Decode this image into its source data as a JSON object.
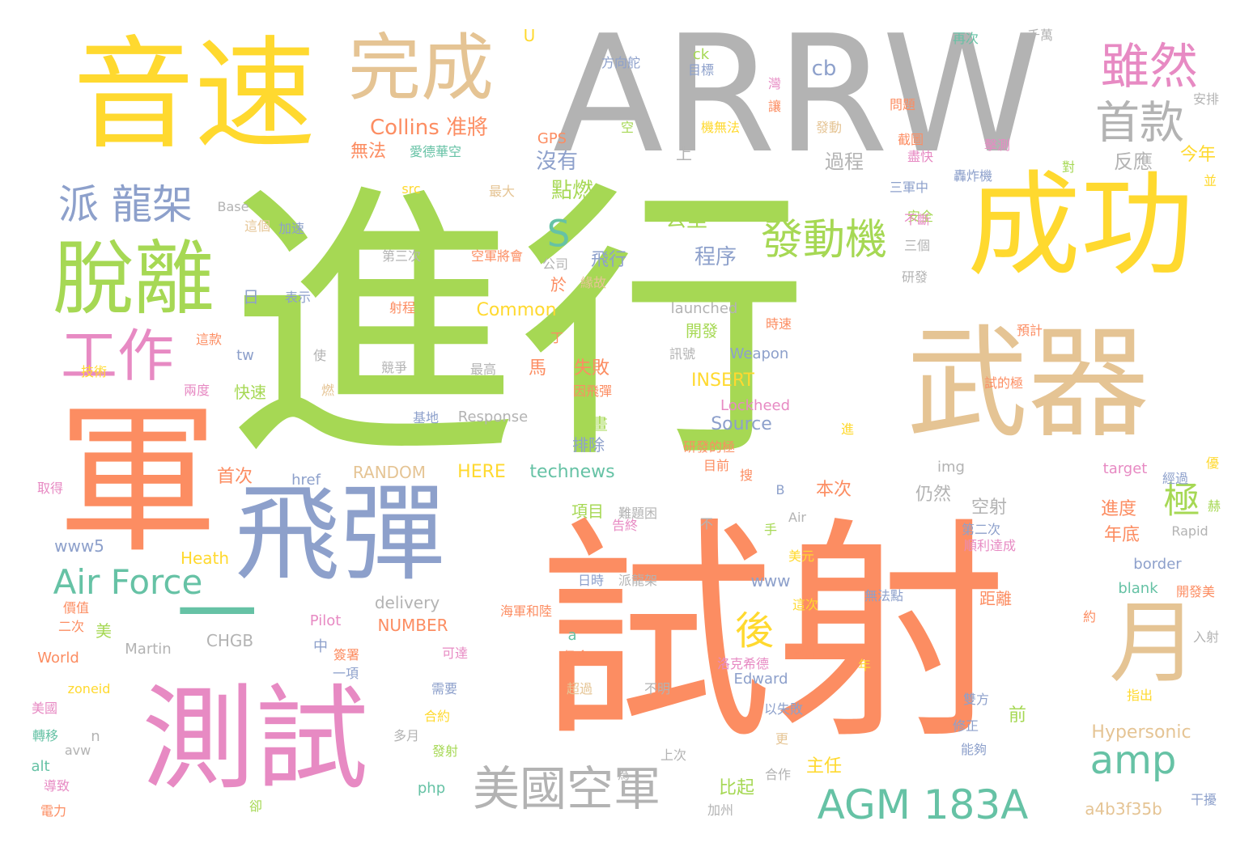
{
  "palette": {
    "green": "#a6d854",
    "orange": "#fc8d62",
    "yellow": "#ffd92f",
    "gray": "#b3b3b3",
    "tan": "#e5c494",
    "blue": "#8da0cb",
    "pink": "#e78ac3",
    "teal": "#66c2a5"
  },
  "words": [
    {
      "text": "進行",
      "color": "green"
    },
    {
      "text": "試射",
      "color": "orange"
    },
    {
      "text": "ARRW",
      "color": "gray"
    },
    {
      "text": "音速",
      "color": "yellow"
    },
    {
      "text": "成功",
      "color": "yellow"
    },
    {
      "text": "武器",
      "color": "tan"
    },
    {
      "text": "軍",
      "color": "orange"
    },
    {
      "text": "測試",
      "color": "pink"
    },
    {
      "text": "飛彈",
      "color": "blue"
    },
    {
      "text": "脫離",
      "color": "green"
    },
    {
      "text": "完成",
      "color": "tan"
    },
    {
      "text": "月",
      "color": "tan"
    },
    {
      "text": "雖然",
      "color": "pink"
    },
    {
      "text": "首款",
      "color": "gray"
    },
    {
      "text": "工作",
      "color": "pink"
    },
    {
      "text": "派 龍架",
      "color": "blue"
    },
    {
      "text": "發動機",
      "color": "green"
    },
    {
      "text": "美國空軍",
      "color": "gray"
    },
    {
      "text": "AGM 183A",
      "color": "teal"
    },
    {
      "text": "Air Force",
      "color": "teal"
    },
    {
      "text": "amp",
      "color": "teal"
    },
    {
      "text": "極",
      "color": "green"
    },
    {
      "text": "後",
      "color": "yellow"
    },
    {
      "text": "S",
      "color": "teal"
    },
    {
      "text": "一",
      "color": "teal"
    },
    {
      "text": "Collins 准將",
      "color": "orange"
    },
    {
      "text": "無法",
      "color": "orange"
    },
    {
      "text": "愛德華空",
      "color": "teal"
    },
    {
      "text": "沒有",
      "color": "blue"
    },
    {
      "text": "點燃",
      "color": "green"
    },
    {
      "text": "公里",
      "color": "green"
    },
    {
      "text": "程序",
      "color": "blue"
    },
    {
      "text": "飛行",
      "color": "blue"
    },
    {
      "text": "cb",
      "color": "blue"
    },
    {
      "text": "ck",
      "color": "green"
    },
    {
      "text": "U",
      "color": "yellow"
    },
    {
      "text": "目標",
      "color": "blue"
    },
    {
      "text": "方向舵",
      "color": "blue"
    },
    {
      "text": "GPS",
      "color": "orange"
    },
    {
      "text": "機無法",
      "color": "yellow"
    },
    {
      "text": "過程",
      "color": "gray"
    },
    {
      "text": "反應",
      "color": "gray"
    },
    {
      "text": "今年",
      "color": "yellow"
    },
    {
      "text": "再次",
      "color": "teal"
    },
    {
      "text": "千萬",
      "color": "gray"
    },
    {
      "text": "問題",
      "color": "orange"
    },
    {
      "text": "安排",
      "color": "gray"
    },
    {
      "text": "發動",
      "color": "tan"
    },
    {
      "text": "截圖",
      "color": "orange"
    },
    {
      "text": "擊測",
      "color": "pink"
    },
    {
      "text": "盡快",
      "color": "pink"
    },
    {
      "text": "轟炸機",
      "color": "blue"
    },
    {
      "text": "三軍中",
      "color": "blue"
    },
    {
      "text": "研發",
      "color": "gray"
    },
    {
      "text": "安全",
      "color": "green"
    },
    {
      "text": "三個",
      "color": "gray"
    },
    {
      "text": "不斷",
      "color": "pink"
    },
    {
      "text": "src",
      "color": "yellow"
    },
    {
      "text": "最大",
      "color": "tan"
    },
    {
      "text": "Base",
      "color": "gray"
    },
    {
      "text": "加速",
      "color": "blue"
    },
    {
      "text": "這個",
      "color": "tan"
    },
    {
      "text": "第三次",
      "color": "gray"
    },
    {
      "text": "空軍將會",
      "color": "orange"
    },
    {
      "text": "公司",
      "color": "gray"
    },
    {
      "text": "日",
      "color": "blue"
    },
    {
      "text": "表示",
      "color": "blue"
    },
    {
      "text": "於",
      "color": "orange"
    },
    {
      "text": "緣故",
      "color": "tan"
    },
    {
      "text": "射程",
      "color": "orange"
    },
    {
      "text": "Common",
      "color": "yellow"
    },
    {
      "text": "launched",
      "color": "gray"
    },
    {
      "text": "開發",
      "color": "green"
    },
    {
      "text": "時速",
      "color": "orange"
    },
    {
      "text": "預計",
      "color": "orange"
    },
    {
      "text": "tw",
      "color": "blue"
    },
    {
      "text": "這款",
      "color": "orange"
    },
    {
      "text": "技術",
      "color": "yellow"
    },
    {
      "text": "競爭",
      "color": "gray"
    },
    {
      "text": "最高",
      "color": "gray"
    },
    {
      "text": "馬",
      "color": "orange"
    },
    {
      "text": "失敗",
      "color": "orange"
    },
    {
      "text": "訊號",
      "color": "gray"
    },
    {
      "text": "Weapon",
      "color": "blue"
    },
    {
      "text": "快速",
      "color": "green"
    },
    {
      "text": "兩度",
      "color": "pink"
    },
    {
      "text": "燃",
      "color": "tan"
    },
    {
      "text": "因飛彈",
      "color": "orange"
    },
    {
      "text": "INSERT",
      "color": "yellow"
    },
    {
      "text": "試的極",
      "color": "orange"
    },
    {
      "text": "Lockheed",
      "color": "pink"
    },
    {
      "text": "基地",
      "color": "blue"
    },
    {
      "text": "Response",
      "color": "gray"
    },
    {
      "text": "Source",
      "color": "blue"
    },
    {
      "text": "計畫",
      "color": "green"
    },
    {
      "text": "排除",
      "color": "blue"
    },
    {
      "text": "研發的極",
      "color": "orange"
    },
    {
      "text": "目前",
      "color": "orange"
    },
    {
      "text": "RANDOM",
      "color": "tan"
    },
    {
      "text": "HERE",
      "color": "yellow"
    },
    {
      "text": "technews",
      "color": "teal"
    },
    {
      "text": "首次",
      "color": "orange"
    },
    {
      "text": "href",
      "color": "blue"
    },
    {
      "text": "取得",
      "color": "pink"
    },
    {
      "text": "img",
      "color": "gray"
    },
    {
      "text": "target",
      "color": "pink"
    },
    {
      "text": "經過",
      "color": "blue"
    },
    {
      "text": "本次",
      "color": "orange"
    },
    {
      "text": "仍然",
      "color": "gray"
    },
    {
      "text": "空射",
      "color": "gray"
    },
    {
      "text": "進度",
      "color": "orange"
    },
    {
      "text": "年底",
      "color": "orange"
    },
    {
      "text": "項目",
      "color": "green"
    },
    {
      "text": "難題困",
      "color": "gray"
    },
    {
      "text": "告終",
      "color": "pink"
    },
    {
      "text": "第二次",
      "color": "blue"
    },
    {
      "text": "順利達成",
      "color": "pink"
    },
    {
      "text": "www5",
      "color": "blue"
    },
    {
      "text": "Heath",
      "color": "yellow"
    },
    {
      "text": "Rapid",
      "color": "gray"
    },
    {
      "text": "border",
      "color": "blue"
    },
    {
      "text": "www",
      "color": "blue"
    },
    {
      "text": "日時",
      "color": "blue"
    },
    {
      "text": "派龍架",
      "color": "gray"
    },
    {
      "text": "delivery",
      "color": "gray"
    },
    {
      "text": "價值",
      "color": "orange"
    },
    {
      "text": "Pilot",
      "color": "pink"
    },
    {
      "text": "海軍和陸",
      "color": "orange"
    },
    {
      "text": "這次",
      "color": "yellow"
    },
    {
      "text": "無法點",
      "color": "blue"
    },
    {
      "text": "距離",
      "color": "orange"
    },
    {
      "text": "blank",
      "color": "teal"
    },
    {
      "text": "開發美",
      "color": "orange"
    },
    {
      "text": "二次",
      "color": "orange"
    },
    {
      "text": "美",
      "color": "green"
    },
    {
      "text": "NUMBER",
      "color": "orange"
    },
    {
      "text": "CHGB",
      "color": "gray"
    },
    {
      "text": "World",
      "color": "orange"
    },
    {
      "text": "Martin",
      "color": "gray"
    },
    {
      "text": "簽署",
      "color": "orange"
    },
    {
      "text": "一項",
      "color": "blue"
    },
    {
      "text": "可達",
      "color": "pink"
    },
    {
      "text": "仍會",
      "color": "orange"
    },
    {
      "text": "洛克希德",
      "color": "pink"
    },
    {
      "text": "影片",
      "color": "orange"
    },
    {
      "text": "Edward",
      "color": "blue"
    },
    {
      "text": "指出",
      "color": "yellow"
    },
    {
      "text": "zoneid",
      "color": "yellow"
    },
    {
      "text": "美國",
      "color": "pink"
    },
    {
      "text": "需要",
      "color": "blue"
    },
    {
      "text": "超過",
      "color": "tan"
    },
    {
      "text": "不明",
      "color": "gray"
    },
    {
      "text": "以失敗",
      "color": "blue"
    },
    {
      "text": "雙方",
      "color": "blue"
    },
    {
      "text": "前",
      "color": "green"
    },
    {
      "text": "Hypersonic",
      "color": "tan"
    },
    {
      "text": "轉移",
      "color": "teal"
    },
    {
      "text": "多月",
      "color": "gray"
    },
    {
      "text": "修正",
      "color": "blue"
    },
    {
      "text": "合約",
      "color": "yellow"
    },
    {
      "text": "上次",
      "color": "gray"
    },
    {
      "text": "發射",
      "color": "green"
    },
    {
      "text": "能夠",
      "color": "blue"
    },
    {
      "text": "主任",
      "color": "yellow"
    },
    {
      "text": "比起",
      "color": "green"
    },
    {
      "text": "alt",
      "color": "teal"
    },
    {
      "text": "avw",
      "color": "gray"
    },
    {
      "text": "導致",
      "color": "pink"
    },
    {
      "text": "電力",
      "color": "orange"
    },
    {
      "text": "php",
      "color": "teal"
    },
    {
      "text": "a4b3f35b",
      "color": "tan"
    },
    {
      "text": "加州",
      "color": "gray"
    },
    {
      "text": "合作",
      "color": "gray"
    },
    {
      "text": "干擾",
      "color": "blue"
    },
    {
      "text": "入射",
      "color": "gray"
    },
    {
      "text": "Air",
      "color": "gray"
    },
    {
      "text": "B",
      "color": "blue"
    },
    {
      "text": "a",
      "color": "teal"
    },
    {
      "text": "n",
      "color": "gray"
    },
    {
      "text": "上",
      "color": "gray"
    },
    {
      "text": "空",
      "color": "green"
    },
    {
      "text": "中",
      "color": "blue"
    },
    {
      "text": "丁",
      "color": "orange"
    },
    {
      "text": "使",
      "color": "gray"
    },
    {
      "text": "不",
      "color": "gray"
    },
    {
      "text": "更",
      "color": "tan"
    },
    {
      "text": "為",
      "color": "gray"
    },
    {
      "text": "年",
      "color": "yellow"
    },
    {
      "text": "約",
      "color": "orange"
    },
    {
      "text": "優",
      "color": "yellow"
    },
    {
      "text": "赫",
      "color": "green"
    },
    {
      "text": "並",
      "color": "yellow"
    },
    {
      "text": "對",
      "color": "green"
    },
    {
      "text": "進",
      "color": "yellow"
    },
    {
      "text": "搜",
      "color": "orange"
    },
    {
      "text": "手",
      "color": "green"
    },
    {
      "text": "美元",
      "color": "yellow"
    },
    {
      "text": "卻",
      "color": "green"
    },
    {
      "text": "灣",
      "color": "pink"
    },
    {
      "text": "讓",
      "color": "orange"
    }
  ]
}
